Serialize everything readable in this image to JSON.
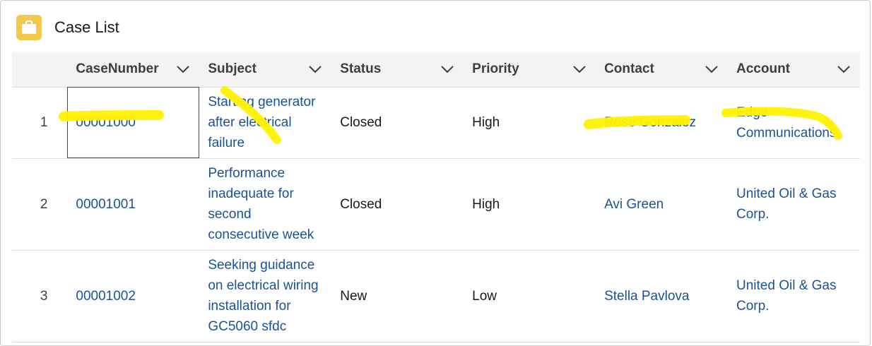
{
  "card": {
    "title": "Case List",
    "icon": "briefcase-icon",
    "icon_color": "#f2c94c"
  },
  "columns": [
    "CaseNumber",
    "Subject",
    "Status",
    "Priority",
    "Contact",
    "Account"
  ],
  "rows": [
    {
      "num": "1",
      "case_number": "00001000",
      "subject": "Starting generator after electrical failure",
      "status": "Closed",
      "priority": "High",
      "contact": "Rose Gonzalez",
      "account": "Edge Communications"
    },
    {
      "num": "2",
      "case_number": "00001001",
      "subject": "Performance inadequate for second consecutive week",
      "status": "Closed",
      "priority": "High",
      "contact": "Avi Green",
      "account": "United Oil & Gas Corp."
    },
    {
      "num": "3",
      "case_number": "00001002",
      "subject": "Seeking guidance on electrical wiring installation for GC5060 sfdc",
      "status": "New",
      "priority": "Low",
      "contact": "Stella Pavlova",
      "account": "United Oil & Gas Corp."
    }
  ],
  "colors": {
    "link": "#1b5297",
    "highlight": "#fff200",
    "header_bg": "#f3f3f3"
  }
}
